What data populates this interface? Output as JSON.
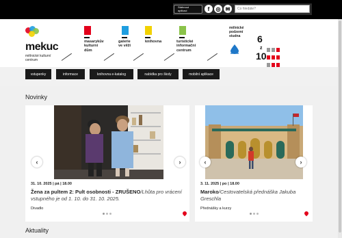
{
  "topbar": {
    "store_label_1": "Stáhnout",
    "store_label_2": "aplikaci",
    "social": [
      "f",
      "◎",
      "✉"
    ],
    "search_placeholder": "Co hledáte?"
  },
  "logo": {
    "title": "mekuc",
    "sub": [
      "mělnické kulturní",
      "centrum"
    ]
  },
  "header_items": [
    {
      "label": [
        "masarykův",
        "kulturní",
        "dům"
      ],
      "color": "#e3001b"
    },
    {
      "label": [
        "galerie",
        "ve věži"
      ],
      "color": "#1f9ee0"
    },
    {
      "label": [
        "knihovna"
      ],
      "color": "#f2d100"
    },
    {
      "label": [
        "turistické",
        "informační",
        "centrum"
      ],
      "color": "#8bc34a"
    }
  ],
  "podzemi": {
    "label": [
      "mělnické",
      "podzemí",
      "studna"
    ],
    "color": "#1f78c8"
  },
  "six_z_ten": {
    "six": "6",
    "z": "z",
    "ten": "10"
  },
  "nav": [
    "vstupenky",
    "informace",
    "knihovna e-katalog",
    "nabídka pro školy",
    "mobilní aplikace"
  ],
  "sections": {
    "news": "Novinky",
    "current": "Aktuality"
  },
  "cards": [
    {
      "date": "31. 10. 2025 | pá | 18.00",
      "title_bold": "Žena za pultem 2: Pult osobnosti - ZRUŠENO",
      "title_rest": "/Lhůta pro vrácení vstupného je od 1. 10. do 31. 10. 2025.",
      "category": "Divadlo"
    },
    {
      "date": "3. 11. 2025 | po | 18.00",
      "title_bold": "Maroko",
      "title_rest": "/Cestovatelská přednáška Jakuba Greschla",
      "category": "Přednášky a kurzy"
    }
  ],
  "arrows": {
    "left": "‹",
    "right": "›"
  },
  "colors": {
    "accent": "#e3001b",
    "nav_bg": "#1a1a1a"
  }
}
